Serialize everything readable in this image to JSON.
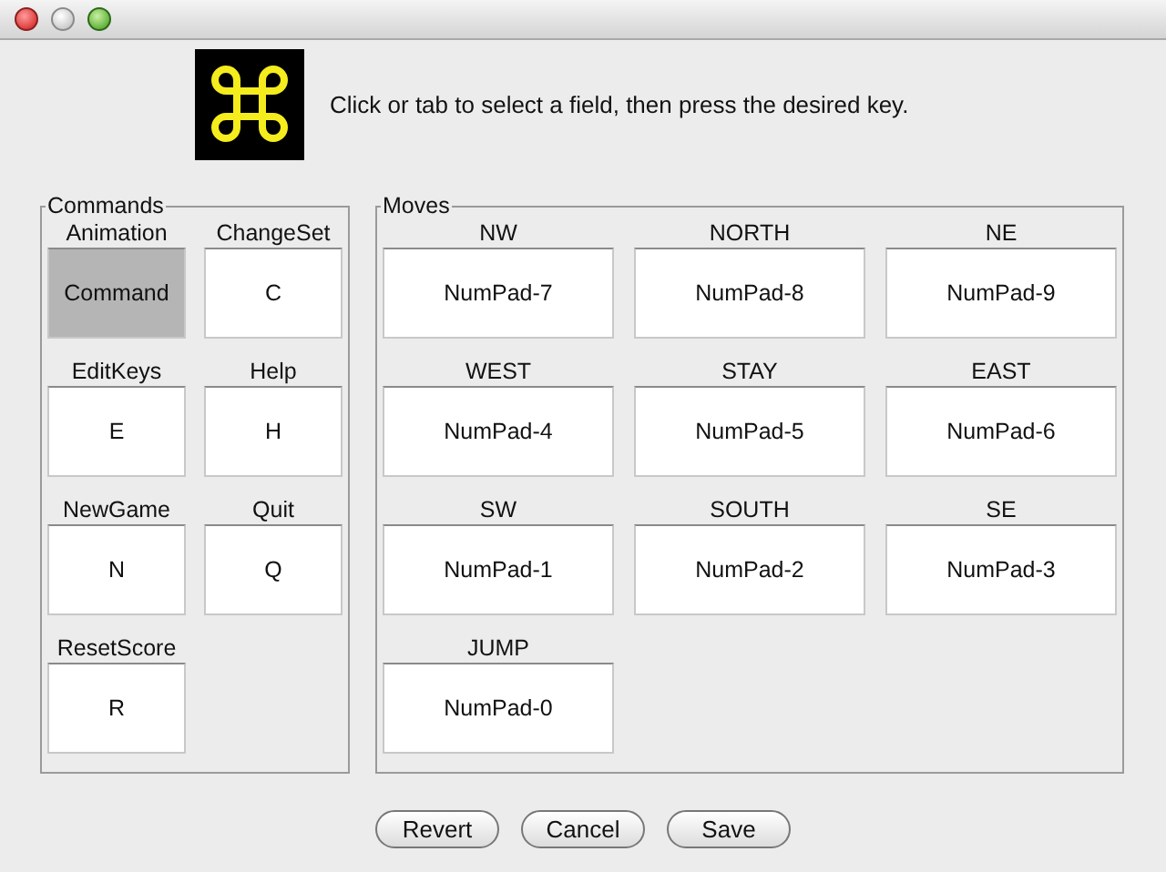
{
  "instruction": "Click or tab to select a field, then press the desired key.",
  "commands": {
    "title": "Commands",
    "items": [
      {
        "label": "Animation",
        "key": "Command",
        "selected": true
      },
      {
        "label": "ChangeSet",
        "key": "C",
        "selected": false
      },
      {
        "label": "EditKeys",
        "key": "E",
        "selected": false
      },
      {
        "label": "Help",
        "key": "H",
        "selected": false
      },
      {
        "label": "NewGame",
        "key": "N",
        "selected": false
      },
      {
        "label": "Quit",
        "key": "Q",
        "selected": false
      },
      {
        "label": "ResetScore",
        "key": "R",
        "selected": false
      }
    ]
  },
  "moves": {
    "title": "Moves",
    "items": [
      {
        "label": "NW",
        "key": "NumPad-7",
        "selected": false
      },
      {
        "label": "NORTH",
        "key": "NumPad-8",
        "selected": false
      },
      {
        "label": "NE",
        "key": "NumPad-9",
        "selected": false
      },
      {
        "label": "WEST",
        "key": "NumPad-4",
        "selected": false
      },
      {
        "label": "STAY",
        "key": "NumPad-5",
        "selected": false
      },
      {
        "label": "EAST",
        "key": "NumPad-6",
        "selected": false
      },
      {
        "label": "SW",
        "key": "NumPad-1",
        "selected": false
      },
      {
        "label": "SOUTH",
        "key": "NumPad-2",
        "selected": false
      },
      {
        "label": "SE",
        "key": "NumPad-3",
        "selected": false
      },
      {
        "label": "JUMP",
        "key": "NumPad-0",
        "selected": false
      }
    ]
  },
  "buttons": [
    "Revert",
    "Cancel",
    "Save"
  ]
}
